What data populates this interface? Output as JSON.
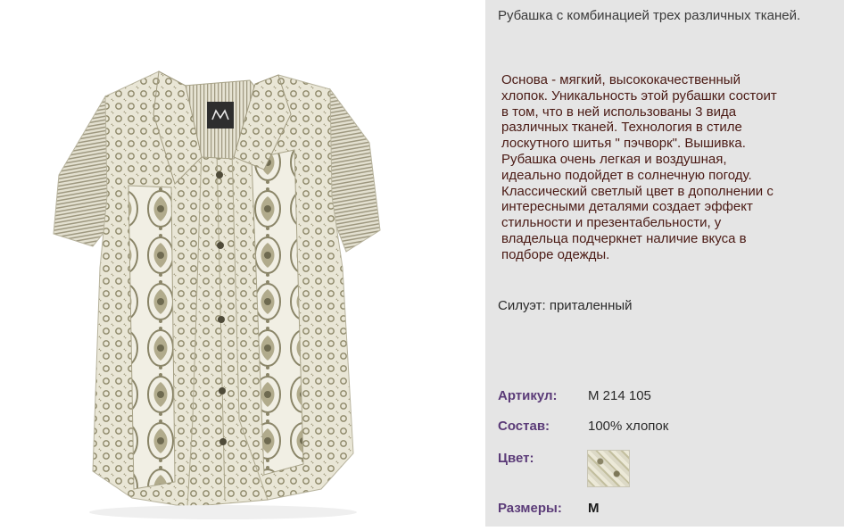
{
  "product": {
    "headline": "Рубашка с комбинацией трех различных тканей.",
    "description": "Основа - мягкий, высококачественный хлопок. Уникальность этой рубашки состоит в том, что в ней использованы 3 вида различных тканей. Технология в стиле лоскутного шитья  \" пэчворк\". Вышивка. Рубашка очень легкая и воздушная, идеально подойдет  в солнечную погоду. Классический светлый цвет в дополнении с интересными деталями создает эффект стильности и презентабельности, у владельца подчеркнет наличие вкуса в подборе одежды.",
    "silhouette": "Силуэт: приталенный"
  },
  "specs": {
    "article_label": "Артикул:",
    "article_value": "M 214 105",
    "composition_label": "Состав:",
    "composition_value": "100% хлопок",
    "color_label": "Цвет:",
    "sizes_label": "Размеры:",
    "sizes_value": "M"
  },
  "colors": {
    "panel_bg": "#e5e5e5",
    "label_purple": "#5b3b78",
    "description_text": "#4a1a14"
  }
}
